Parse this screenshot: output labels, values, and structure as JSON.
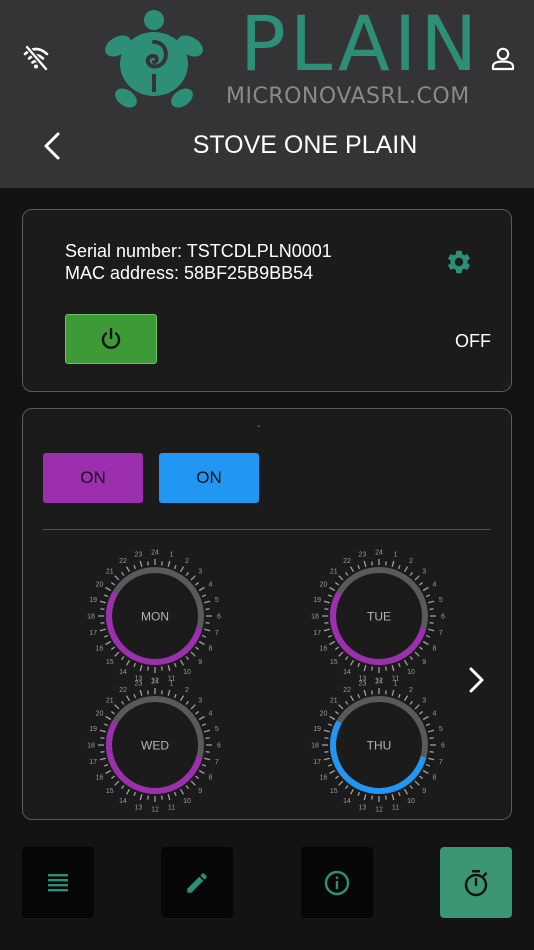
{
  "header": {
    "brand_name": "PLAIN",
    "brand_url": "MICRONOVASRL.COM",
    "title": "STOVE ONE PLAIN"
  },
  "device": {
    "serial_line": "Serial number: TSTCDLPLN0001",
    "mac_line": "MAC address: 58BF25B9BB54",
    "state": "OFF"
  },
  "schedule": {
    "dash": "-",
    "buttons": [
      {
        "label": "ON",
        "color": "#9b2fae"
      },
      {
        "label": "ON",
        "color": "#2196f3"
      }
    ],
    "days": [
      {
        "label": "MON",
        "color": "#9b2fae"
      },
      {
        "label": "TUE",
        "color": "#9b2fae"
      },
      {
        "label": "WED",
        "color": "#9b2fae"
      },
      {
        "label": "THU",
        "color": "#2196f3"
      }
    ],
    "hour_labels": [
      "24",
      "1",
      "2",
      "3",
      "4",
      "5",
      "6",
      "7",
      "8",
      "9",
      "10",
      "11",
      "12",
      "13",
      "14",
      "15",
      "16",
      "17",
      "18",
      "19",
      "20",
      "21",
      "22",
      "23"
    ]
  },
  "colors": {
    "accent": "#2e8f78",
    "power_green": "#3e9a36",
    "header_bg": "#343436"
  },
  "nav": {
    "items": [
      {
        "icon": "list-icon",
        "active": false
      },
      {
        "icon": "pencil-icon",
        "active": false
      },
      {
        "icon": "info-icon",
        "active": false
      },
      {
        "icon": "timer-icon",
        "active": true
      }
    ]
  }
}
